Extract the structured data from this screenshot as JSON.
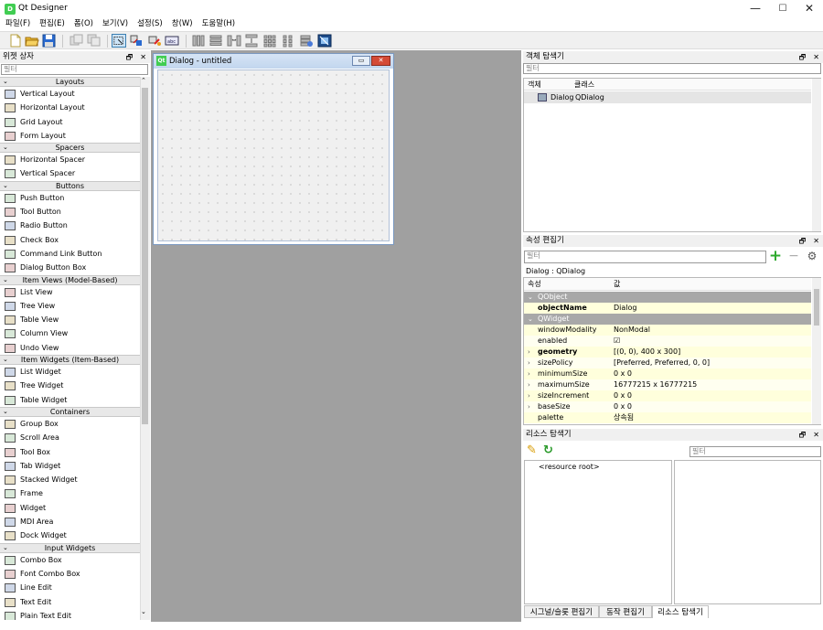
{
  "window": {
    "title": "Qt Designer",
    "minimize": "—",
    "maximize": "☐",
    "close": "✕"
  },
  "menu": [
    "파일(F)",
    "편집(E)",
    "폼(O)",
    "보기(V)",
    "설정(S)",
    "창(W)",
    "도움말(H)"
  ],
  "toolbar_icons": [
    "new-file-icon",
    "open-folder-icon",
    "save-icon",
    "back-icon",
    "forward-icon",
    "edit-widgets-icon",
    "edit-signals-slots-icon",
    "edit-buddies-icon",
    "edit-tab-order-icon",
    "layout-horizontal-icon",
    "layout-vertical-icon",
    "layout-horizontal-splitter-icon",
    "layout-vertical-splitter-icon",
    "layout-grid-icon",
    "layout-form-icon",
    "break-layout-icon",
    "adjust-size-icon"
  ],
  "widget_box": {
    "title": "위젯 상자",
    "filter_placeholder": "필터",
    "categories": [
      {
        "name": "Layouts",
        "items": [
          "Vertical Layout",
          "Horizontal Layout",
          "Grid Layout",
          "Form Layout"
        ]
      },
      {
        "name": "Spacers",
        "items": [
          "Horizontal Spacer",
          "Vertical Spacer"
        ]
      },
      {
        "name": "Buttons",
        "items": [
          "Push Button",
          "Tool Button",
          "Radio Button",
          "Check Box",
          "Command Link Button",
          "Dialog Button Box"
        ]
      },
      {
        "name": "Item Views (Model-Based)",
        "items": [
          "List View",
          "Tree View",
          "Table View",
          "Column View",
          "Undo View"
        ]
      },
      {
        "name": "Item Widgets (Item-Based)",
        "items": [
          "List Widget",
          "Tree Widget",
          "Table Widget"
        ]
      },
      {
        "name": "Containers",
        "items": [
          "Group Box",
          "Scroll Area",
          "Tool Box",
          "Tab Widget",
          "Stacked Widget",
          "Frame",
          "Widget",
          "MDI Area",
          "Dock Widget"
        ]
      },
      {
        "name": "Input Widgets",
        "items": [
          "Combo Box",
          "Font Combo Box",
          "Line Edit",
          "Text Edit",
          "Plain Text Edit"
        ]
      }
    ]
  },
  "dialog": {
    "title": "Dialog - untitled",
    "icon": "Qt"
  },
  "object_inspector": {
    "title": "객체 탐색기",
    "filter_placeholder": "필터",
    "headers": [
      "객체",
      "클래스"
    ],
    "rows": [
      {
        "object": "Dialog",
        "class": "QDialog"
      }
    ]
  },
  "property_editor": {
    "title": "속성 편집기",
    "filter_placeholder": "필터",
    "context": "Dialog : QDialog",
    "headers": [
      "속성",
      "값"
    ],
    "rows": [
      {
        "type": "section",
        "name": "QObject"
      },
      {
        "type": "prop",
        "name": "objectName",
        "value": "Dialog",
        "bold": true,
        "expandable": false
      },
      {
        "type": "section",
        "name": "QWidget"
      },
      {
        "type": "prop",
        "name": "windowModality",
        "value": "NonModal",
        "expandable": false
      },
      {
        "type": "prop",
        "name": "enabled",
        "value": "☑",
        "expandable": false
      },
      {
        "type": "prop",
        "name": "geometry",
        "value": "[(0, 0), 400 x 300]",
        "bold": true,
        "expandable": true
      },
      {
        "type": "prop",
        "name": "sizePolicy",
        "value": "[Preferred, Preferred, 0, 0]",
        "expandable": true
      },
      {
        "type": "prop",
        "name": "minimumSize",
        "value": "0 x 0",
        "expandable": true
      },
      {
        "type": "prop",
        "name": "maximumSize",
        "value": "16777215 x 16777215",
        "expandable": true
      },
      {
        "type": "prop",
        "name": "sizeIncrement",
        "value": "0 x 0",
        "expandable": true
      },
      {
        "type": "prop",
        "name": "baseSize",
        "value": "0 x 0",
        "expandable": true
      },
      {
        "type": "prop",
        "name": "palette",
        "value": "상속됨",
        "expandable": false
      }
    ]
  },
  "resource_browser": {
    "title": "리소스 탐색기",
    "filter_placeholder": "필터",
    "root": "<resource root>"
  },
  "bottom_tabs": [
    "시그널/슬롯 편집기",
    "동작 편집기",
    "리소스 탐색기"
  ],
  "colors": {
    "section_bg": "#a8a8a8",
    "highlight_row": "#ffffdc",
    "mdi_bg": "#a0a0a0",
    "accent": "#41cd52"
  }
}
